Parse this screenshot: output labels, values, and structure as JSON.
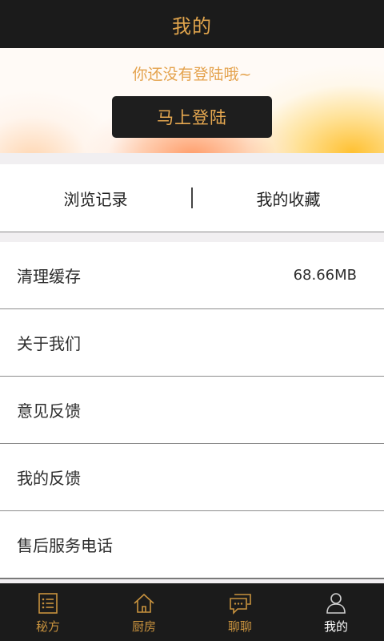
{
  "header": {
    "title": "我的"
  },
  "login": {
    "prompt": "你还没有登陆哦~",
    "button_label": "马上登陆"
  },
  "quick_links": {
    "history": "浏览记录",
    "favorites": "我的收藏"
  },
  "settings": {
    "clear_cache": {
      "label": "清理缓存",
      "value": "68.66MB"
    },
    "about": {
      "label": "关于我们"
    },
    "feedback": {
      "label": "意见反馈"
    },
    "my_feedback": {
      "label": "我的反馈"
    },
    "service_phone": {
      "label": "售后服务电话"
    }
  },
  "tabbar": {
    "items": [
      {
        "label": "秘方",
        "icon": "list-icon"
      },
      {
        "label": "厨房",
        "icon": "house-icon"
      },
      {
        "label": "聊聊",
        "icon": "chat-icon"
      },
      {
        "label": "我的",
        "icon": "person-icon",
        "active": true
      }
    ]
  },
  "colors": {
    "accent": "#e0a44c",
    "dark": "#1b1b1b"
  }
}
